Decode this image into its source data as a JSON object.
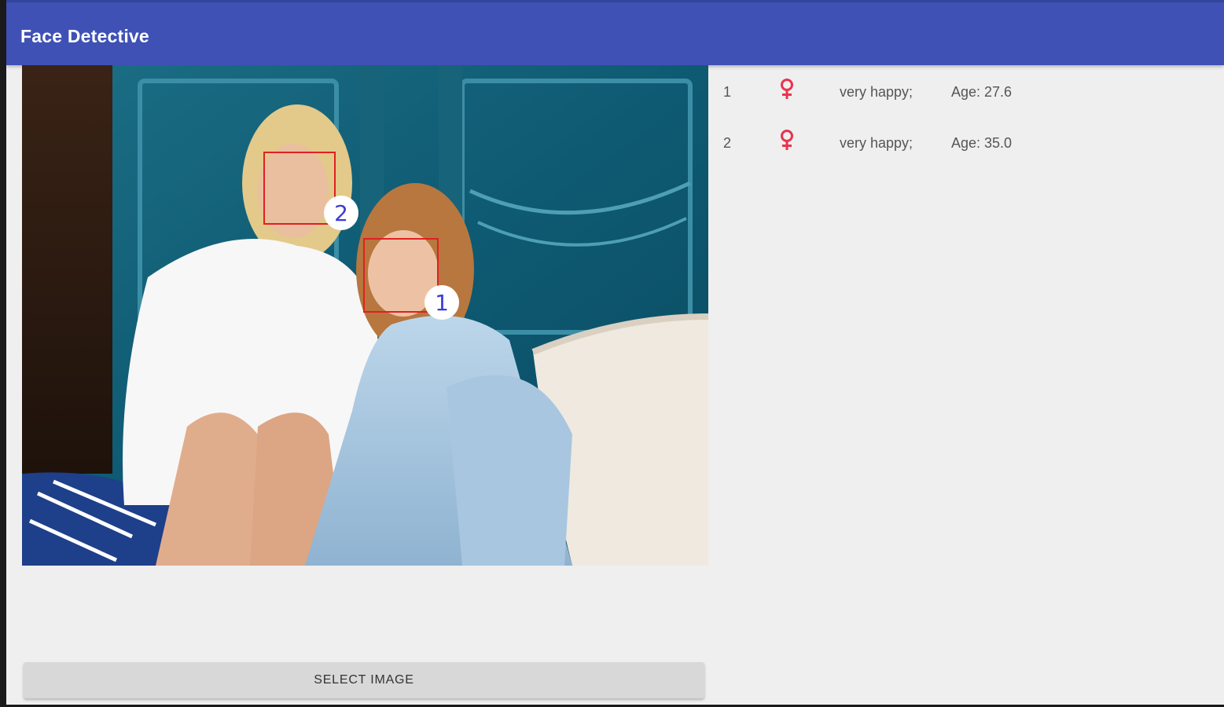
{
  "app": {
    "title": "Face Detective",
    "colors": {
      "appbar": "#3f51b5",
      "background": "#efefef",
      "face_box": "#e02020",
      "badge_text": "#3b3bd8",
      "female_icon": "#e8344e"
    }
  },
  "image": {
    "faces": [
      {
        "label": "2"
      },
      {
        "label": "1"
      }
    ]
  },
  "results": [
    {
      "index": "1",
      "gender_icon": "female-icon",
      "gender_glyph": "♀",
      "emotion": "very happy;",
      "age": "Age: 27.6"
    },
    {
      "index": "2",
      "gender_icon": "female-icon",
      "gender_glyph": "♀",
      "emotion": "very happy;",
      "age": "Age: 35.0"
    }
  ],
  "actions": {
    "select_image_label": "SELECT IMAGE"
  }
}
